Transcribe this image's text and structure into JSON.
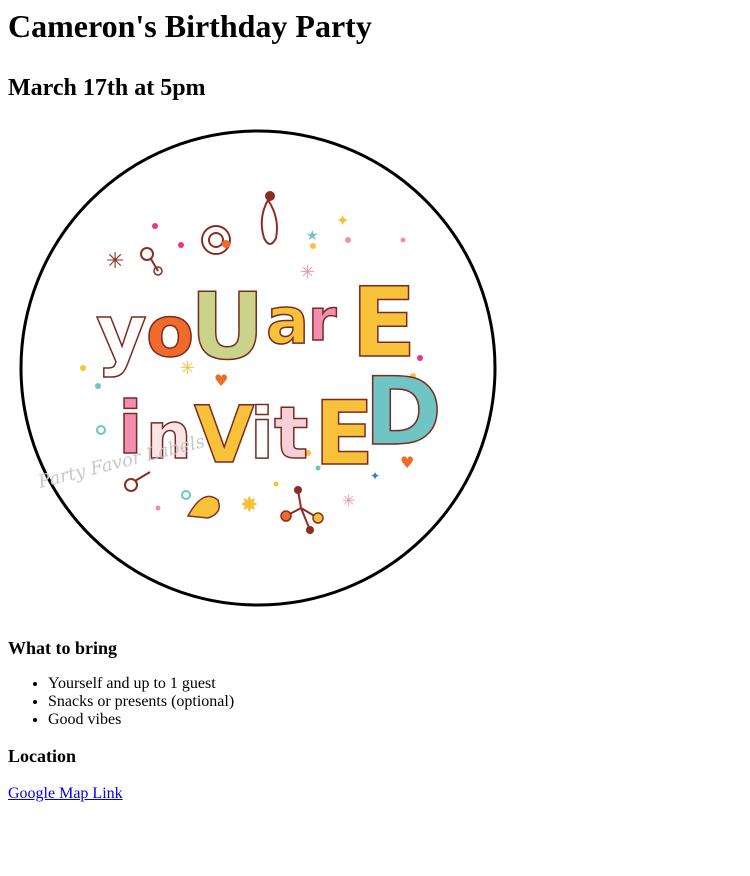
{
  "title": "Cameron's Birthday Party",
  "date": "March 17th at 5pm",
  "invite_image": {
    "line1": "YOU ARE",
    "line2": "INVITED",
    "watermark": "Party Favor Labels",
    "colors": {
      "orange": "#f06a2a",
      "yellow": "#f7c23a",
      "teal": "#6fc5c3",
      "pink": "#f28fb0",
      "brown": "#8a2e23",
      "green": "#c9d38a"
    }
  },
  "bring": {
    "heading": "What to bring",
    "items": [
      "Yourself and up to 1 guest",
      "Snacks or presents (optional)",
      "Good vibes"
    ]
  },
  "location": {
    "heading": "Location",
    "link_text": "Google Map Link"
  }
}
